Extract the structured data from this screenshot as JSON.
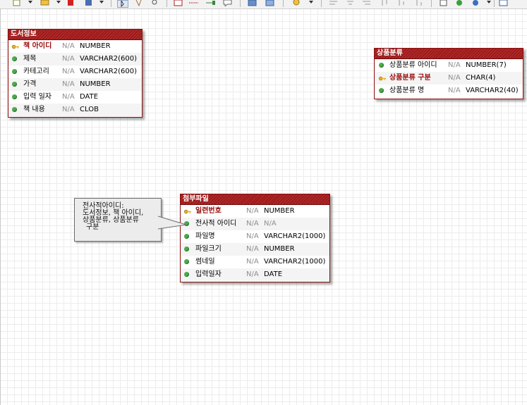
{
  "entities": {
    "book_info": {
      "title": "도서정보",
      "rows": [
        {
          "name": "책 아이디",
          "na": "N/A",
          "type": "NUMBER",
          "key": true
        },
        {
          "name": "제목",
          "na": "N/A",
          "type": "VARCHAR2(600)",
          "key": false
        },
        {
          "name": "카테고리",
          "na": "N/A",
          "type": "VARCHAR2(600)",
          "key": false
        },
        {
          "name": "가격",
          "na": "N/A",
          "type": "NUMBER",
          "key": false
        },
        {
          "name": "입력 일자",
          "na": "N/A",
          "type": "DATE",
          "key": false
        },
        {
          "name": "책 내용",
          "na": "N/A",
          "type": "CLOB",
          "key": false
        }
      ]
    },
    "product_category": {
      "title": "상품분류",
      "rows": [
        {
          "name": "상품분류 아이디",
          "na": "N/A",
          "type": "NUMBER(7)",
          "key": false
        },
        {
          "name": "상품분류 구분",
          "na": "N/A",
          "type": "CHAR(4)",
          "key": true
        },
        {
          "name": "상품분류 명",
          "na": "N/A",
          "type": "VARCHAR2(40)",
          "key": false
        }
      ]
    },
    "attachment": {
      "title": "첨부파일",
      "rows": [
        {
          "name": "일련번호",
          "na": "N/A",
          "type": "NUMBER",
          "key": true
        },
        {
          "name": "전사적 아이디",
          "na": "N/A",
          "type": "N/A",
          "key": false
        },
        {
          "name": "파일명",
          "na": "N/A",
          "type": "VARCHAR2(1000)",
          "key": false
        },
        {
          "name": "파일크기",
          "na": "N/A",
          "type": "NUMBER",
          "key": false
        },
        {
          "name": "썸네일",
          "na": "N/A",
          "type": "VARCHAR2(1000)",
          "key": false
        },
        {
          "name": "입력일자",
          "na": "N/A",
          "type": "DATE",
          "key": false
        }
      ]
    }
  },
  "note": {
    "lines": [
      "전사적아이디:",
      "도서정보, 책 아이디,",
      "상품분류, 상품분류",
      "구분"
    ]
  },
  "colors": {
    "entity_header": "#a01818",
    "primary_key_text": "#9b0a0a",
    "attribute_dot": "#4da84d",
    "key_icon": "#e6b422",
    "na_text": "#8e8e8e"
  },
  "icons": [
    "key-icon",
    "attribute-icon"
  ]
}
